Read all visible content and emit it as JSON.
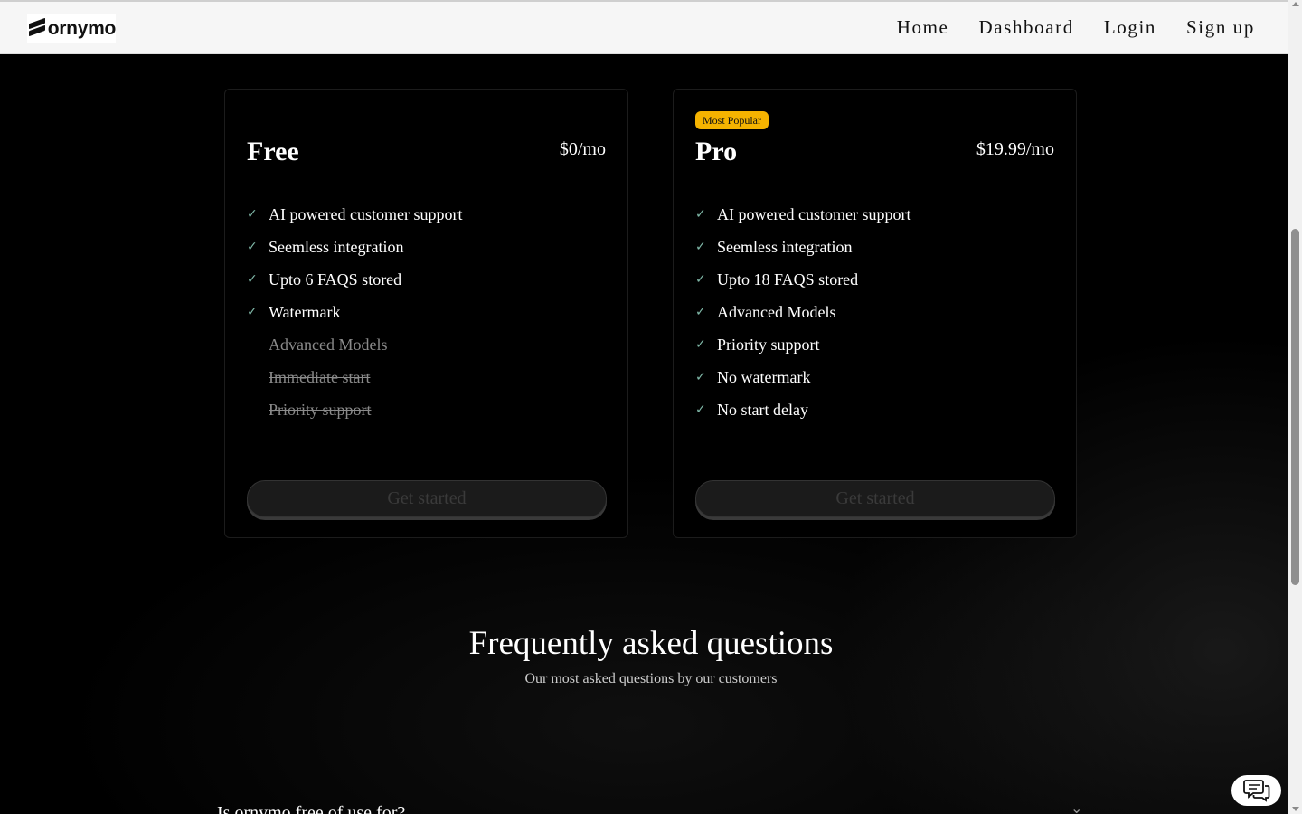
{
  "nav": {
    "logo_text": "ornymo",
    "links": [
      "Home",
      "Dashboard",
      "Login",
      "Sign up"
    ]
  },
  "plans": [
    {
      "name": "Free",
      "price": "$0/mo",
      "badge": "",
      "features": [
        {
          "text": "AI powered customer support",
          "included": true
        },
        {
          "text": "Seemless integration",
          "included": true
        },
        {
          "text": "Upto 6 FAQS stored",
          "included": true
        },
        {
          "text": "Watermark",
          "included": true
        },
        {
          "text": "Advanced Models",
          "included": false
        },
        {
          "text": "Immediate start",
          "included": false
        },
        {
          "text": "Priority support",
          "included": false
        }
      ],
      "cta": "Get started"
    },
    {
      "name": "Pro",
      "price": "$19.99/mo",
      "badge": "Most Popular",
      "features": [
        {
          "text": "AI powered customer support",
          "included": true
        },
        {
          "text": "Seemless integration",
          "included": true
        },
        {
          "text": "Upto 18 FAQS stored",
          "included": true
        },
        {
          "text": "Advanced Models",
          "included": true
        },
        {
          "text": "Priority support",
          "included": true
        },
        {
          "text": "No watermark",
          "included": true
        },
        {
          "text": "No start delay",
          "included": true
        }
      ],
      "cta": "Get started"
    }
  ],
  "faq": {
    "title": "Frequently asked questions",
    "subtitle": "Our most asked questions by our customers",
    "first_question": "Is ornymo free of use for?",
    "chevron_icon": "chevron-down-icon"
  },
  "chat": {
    "icon": "chat-bubbles-icon"
  },
  "colors": {
    "accent_badge": "#f5b300",
    "check": "#7fb7a7",
    "background": "#000000"
  }
}
